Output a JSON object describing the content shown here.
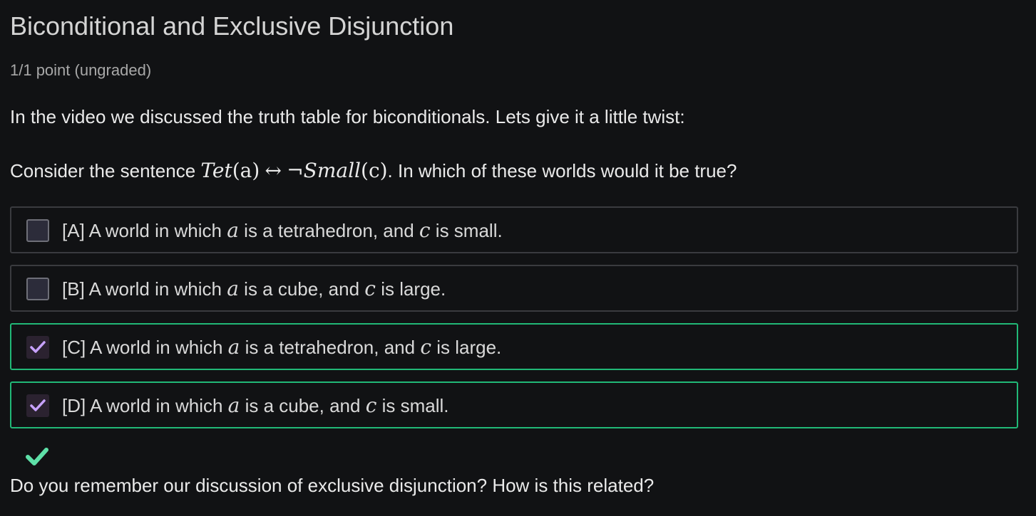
{
  "question": {
    "title": "Biconditional and Exclusive Disjunction",
    "points": "1/1 point (ungraded)",
    "intro": "In the video we discussed the truth table for biconditionals. Lets give it a little twist:",
    "prompt_before": "Consider the sentence ",
    "formula": {
      "tet": "Tet",
      "arg1": "(a)",
      "iff": "↔",
      "neg": "¬",
      "small": "Small",
      "arg2": "(c)"
    },
    "prompt_after": ". In which of these worlds would it be true?",
    "followup": "Do you remember our discussion of exclusive disjunction? How is this related?"
  },
  "options": [
    {
      "label": "[A] A world in which ",
      "var1": "a",
      "mid": " is a tetrahedron, and ",
      "var2": "c",
      "end": " is small.",
      "checked": false,
      "correct": false
    },
    {
      "label": "[B] A world in which ",
      "var1": "a",
      "mid": " is a cube, and ",
      "var2": "c",
      "end": " is large.",
      "checked": false,
      "correct": false
    },
    {
      "label": "[C] A world in which ",
      "var1": "a",
      "mid": " is a tetrahedron, and ",
      "var2": "c",
      "end": " is large.",
      "checked": true,
      "correct": true
    },
    {
      "label": "[D] A world in which ",
      "var1": "a",
      "mid": " is a cube, and ",
      "var2": "c",
      "end": " is small.",
      "checked": true,
      "correct": true
    }
  ],
  "result": {
    "icon": "check-icon",
    "status": "correct",
    "color": "#5ee0a8"
  },
  "colors": {
    "background": "#111214",
    "correct_border": "#21b877",
    "checkmark": "#c8a2ff",
    "result_check": "#5ee0a8"
  }
}
